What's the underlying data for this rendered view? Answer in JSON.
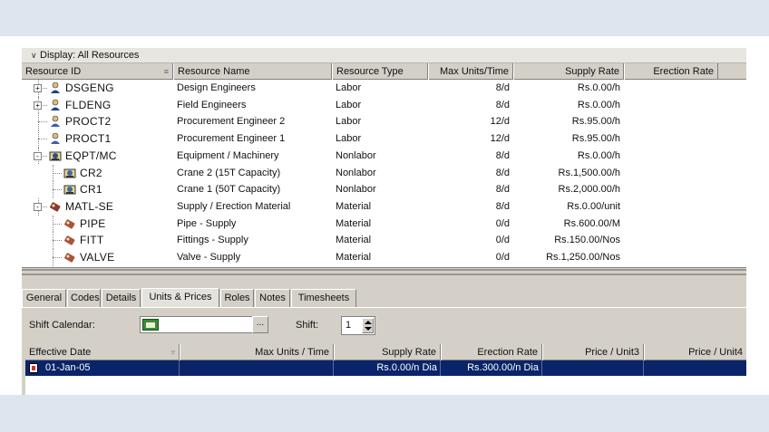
{
  "display_filter": "Display: All Resources",
  "columns": {
    "resource_id": "Resource ID",
    "resource_name": "Resource Name",
    "resource_type": "Resource Type",
    "max_units_time": "Max Units/Time",
    "supply_rate": "Supply Rate",
    "erection_rate": "Erection Rate"
  },
  "resources": [
    {
      "id": "DSGENG",
      "name": "Design Engineers",
      "type": "Labor",
      "max_units": "8/d",
      "supply_rate": "Rs.0.00/h",
      "icon": "labor-group-icon",
      "expander": "+"
    },
    {
      "id": "FLDENG",
      "name": "Field Engineers",
      "type": "Labor",
      "max_units": "8/d",
      "supply_rate": "Rs.0.00/h",
      "icon": "labor-group-icon",
      "expander": "+"
    },
    {
      "id": "PROCT2",
      "name": "Procurement Engineer 2",
      "type": "Labor",
      "max_units": "12/d",
      "supply_rate": "Rs.95.00/h",
      "icon": "labor-person-icon",
      "expander": ""
    },
    {
      "id": "PROCT1",
      "name": "Procurement Engineer 1",
      "type": "Labor",
      "max_units": "12/d",
      "supply_rate": "Rs.95.00/h",
      "icon": "labor-person-icon",
      "expander": ""
    },
    {
      "id": "EQPT/MC",
      "name": "Equipment / Machinery",
      "type": "Nonlabor",
      "max_units": "8/d",
      "supply_rate": "Rs.0.00/h",
      "icon": "nonlabor-group-icon",
      "expander": "-"
    },
    {
      "id": "CR2",
      "name": "Crane 2 (15T Capacity)",
      "type": "Nonlabor",
      "max_units": "8/d",
      "supply_rate": "Rs.1,500.00/h",
      "icon": "nonlabor-icon",
      "expander": ""
    },
    {
      "id": "CR1",
      "name": "Crane 1 (50T Capacity)",
      "type": "Nonlabor",
      "max_units": "8/d",
      "supply_rate": "Rs.2,000.00/h",
      "icon": "nonlabor-icon",
      "expander": ""
    },
    {
      "id": "MATL-SE",
      "name": "Supply / Erection Material",
      "type": "Material",
      "max_units": "8/d",
      "supply_rate": "Rs.0.00/unit",
      "icon": "material-group-icon",
      "expander": "-"
    },
    {
      "id": "PIPE",
      "name": "Pipe - Supply",
      "type": "Material",
      "max_units": "0/d",
      "supply_rate": "Rs.600.00/M",
      "icon": "material-icon",
      "expander": ""
    },
    {
      "id": "FITT",
      "name": "Fittings - Supply",
      "type": "Material",
      "max_units": "0/d",
      "supply_rate": "Rs.150.00/Nos",
      "icon": "material-icon",
      "expander": ""
    },
    {
      "id": "VALVE",
      "name": "Valve - Supply",
      "type": "Material",
      "max_units": "0/d",
      "supply_rate": "Rs.1,250.00/Nos",
      "icon": "material-icon",
      "expander": ""
    }
  ],
  "tabs": [
    "General",
    "Codes",
    "Details",
    "Units & Prices",
    "Roles",
    "Notes",
    "Timesheets"
  ],
  "active_tab": "Units & Prices",
  "details": {
    "shift_calendar_label": "Shift Calendar:",
    "shift_calendar_value": "",
    "ellipsis": "...",
    "shift_label": "Shift:",
    "shift_value": "1"
  },
  "price_columns": {
    "effective_date": "Effective Date",
    "max_units_time": "Max Units / Time",
    "supply_rate": "Supply Rate",
    "erection_rate": "Erection Rate",
    "price_unit3": "Price / Unit3",
    "price_unit4": "Price / Unit4"
  },
  "price_rows": [
    {
      "effective_date": "01-Jan-05",
      "max_units_time": "",
      "supply_rate": "Rs.0.00/n Dia",
      "erection_rate": "Rs.300.00/n Dia",
      "price_unit3": "",
      "price_unit4": ""
    }
  ],
  "colors": {
    "selection": "#0a246a",
    "labor": "#1f3f9a",
    "nonlabor": "#2a4f8a",
    "material": "#8a3a2a"
  }
}
